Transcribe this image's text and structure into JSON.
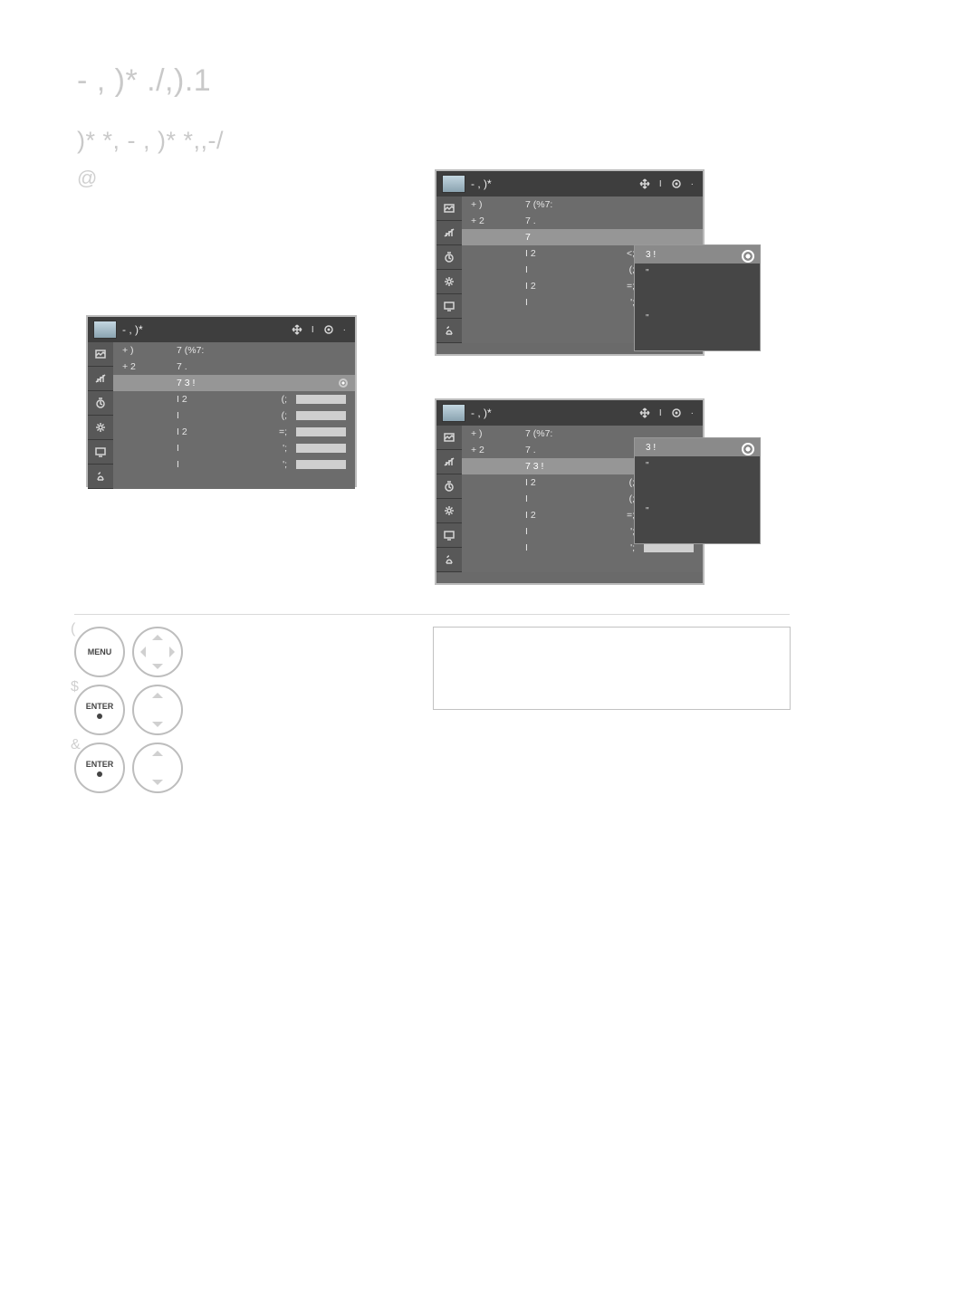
{
  "page_title": "- , )*  ./,).1",
  "section_heading": ")* *,   - , )*   *,,-/",
  "intro_at_symbol": "@",
  "panels": {
    "title": "- , )*",
    "move_label": "I",
    "enter_label": "·",
    "rows": {
      "r1_c1": "+    )",
      "r1_c2": "7 (%7:",
      "r2_c1": "+    2",
      "r2_c2": "7 .",
      "hl": "7 3 !",
      "hl_alt": "7",
      "s1_c2": "I 2",
      "s1_v": "<;",
      "s2_c2": "I",
      "s2_v": "(;",
      "s3_c2": "I 2",
      "s3_v": "=;",
      "s4_c2": "I",
      "s4_v": "';",
      "s5_c2": "I",
      "s5_v": "';",
      "alt_s1_v": "(;",
      "alt_s2_v": "(;",
      "alt_s3_v": "=;",
      "alt_s4_v": "';",
      "alt_s5_v": "';"
    },
    "popup": {
      "sel": "3 !",
      "o1": "\"",
      "o2": "\""
    }
  },
  "steps": {
    "n1": "(",
    "n2": "$",
    "n3": "&",
    "menu": "MENU",
    "enter": "ENTER"
  }
}
